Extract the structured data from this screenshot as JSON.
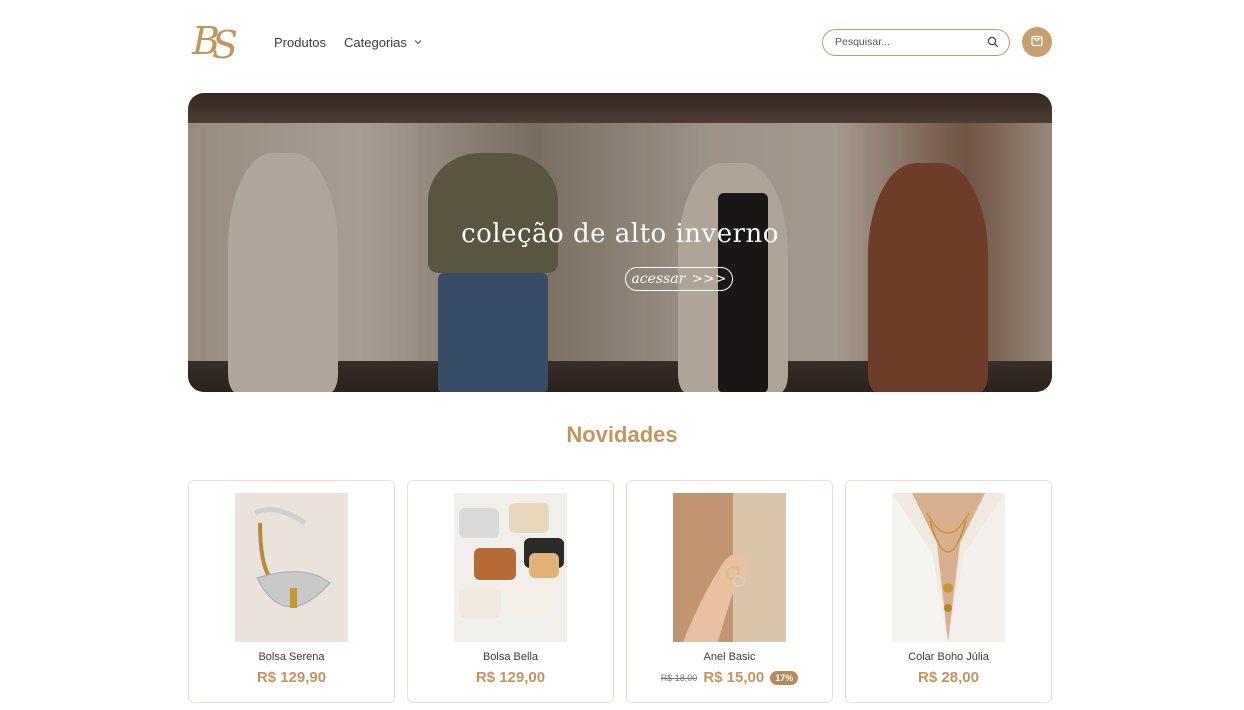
{
  "brand": {
    "logo_text": "BS",
    "accent": "#c29661"
  },
  "nav": {
    "items": [
      {
        "label": "Produtos"
      },
      {
        "label": "Categorias"
      }
    ]
  },
  "search": {
    "placeholder": "Pesquisar..."
  },
  "banner": {
    "title": "coleção de alto inverno",
    "button_label": "acessar",
    "button_arrows": ">>>"
  },
  "section": {
    "title": "Novidades"
  },
  "products": [
    {
      "name": "Bolsa Serena",
      "price": "R$ 129,90",
      "old_price": "",
      "discount": ""
    },
    {
      "name": "Bolsa Bella",
      "price": "R$ 129,00",
      "old_price": "",
      "discount": ""
    },
    {
      "name": "Anel Basic",
      "price": "R$ 15,00",
      "old_price": "R$ 18,00",
      "discount": "17%"
    },
    {
      "name": "Colar Boho Júlia",
      "price": "R$ 28,00",
      "old_price": "",
      "discount": ""
    }
  ]
}
